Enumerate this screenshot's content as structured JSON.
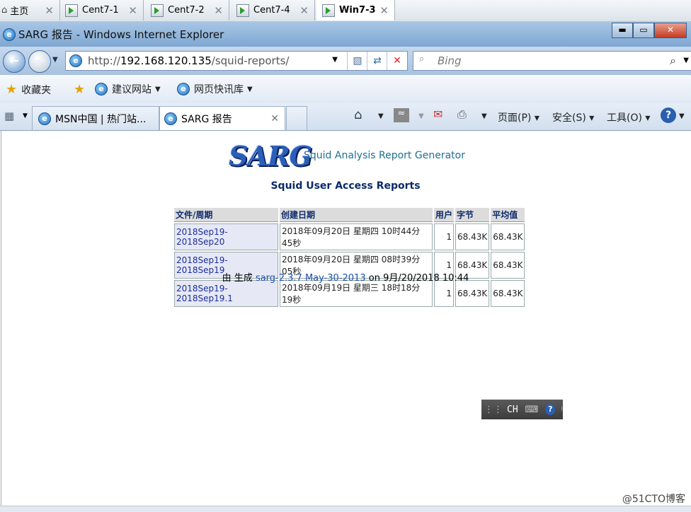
{
  "vm_tabs": [
    {
      "label": "主页"
    },
    {
      "label": "Cent7-1"
    },
    {
      "label": "Cent7-2"
    },
    {
      "label": "Cent7-4"
    },
    {
      "label": "Win7-3"
    }
  ],
  "window": {
    "title": "SARG 报告 - Windows Internet Explorer"
  },
  "address_bar": {
    "url_prefix": "http://",
    "url_host": "192.168.120.135",
    "url_path": "/squid-reports/"
  },
  "search_box": {
    "placeholder": "Bing"
  },
  "favorites_bar": {
    "favorites_label": "收藏夹",
    "suggested_sites": "建议网站",
    "web_slice": "网页快讯库"
  },
  "page_tabs": [
    {
      "label": "MSN中国 | 热门站..."
    },
    {
      "label": "SARG 报告"
    }
  ],
  "command_bar": {
    "page": "页面(P)",
    "safety": "安全(S)",
    "tools": "工具(O)"
  },
  "report": {
    "logo_text": "SARG",
    "generator": "Squid Analysis Report Generator",
    "heading": "Squid User Access Reports",
    "columns": [
      "文件/周期",
      "创建日期",
      "用户",
      "字节",
      "平均值"
    ],
    "rows": [
      {
        "period": "2018Sep19-2018Sep20",
        "created": "2018年09月20日 星期四 10时44分45秒",
        "users": "1",
        "bytes": "68.43K",
        "avg": "68.43K"
      },
      {
        "period": "2018Sep19-2018Sep19",
        "created": "2018年09月20日 星期四 08时39分05秒",
        "users": "1",
        "bytes": "68.43K",
        "avg": "68.43K"
      },
      {
        "period": "2018Sep19-2018Sep19.1",
        "created": "2018年09月19日 星期三 18时18分19秒",
        "users": "1",
        "bytes": "68.43K",
        "avg": "68.43K"
      }
    ],
    "footer_by": "由 生成",
    "footer_version": "sarg-2.3.7 May-30-2013",
    "footer_on": "on 9月/20/2018 10:44"
  },
  "language_bar": {
    "label": "CH"
  },
  "watermark": "@51CTO博客"
}
